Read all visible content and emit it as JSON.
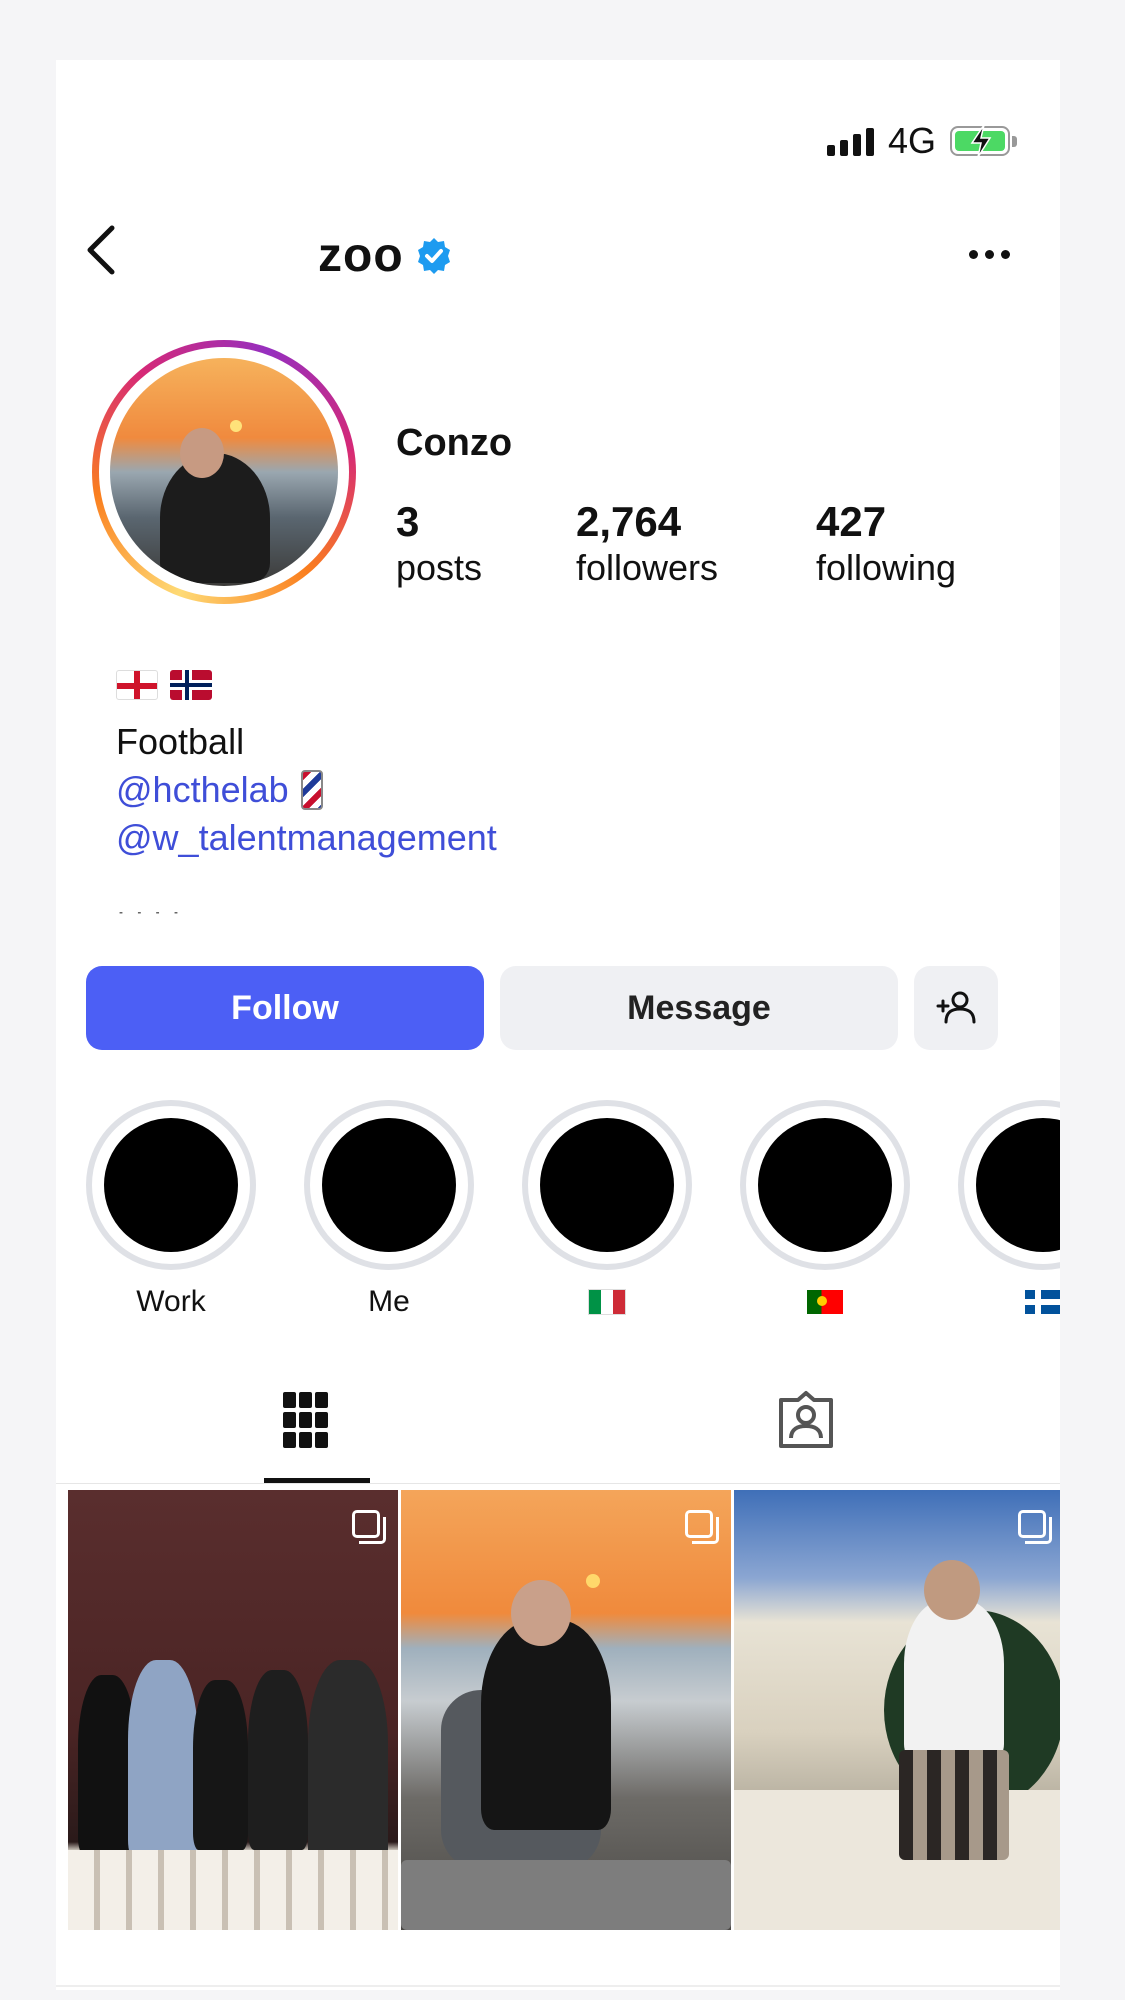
{
  "status_bar": {
    "network": "4G"
  },
  "header": {
    "username_partial": "zoo",
    "icons": [
      "back-chevron-icon",
      "verified-badge-icon",
      "more-options-icon"
    ]
  },
  "profile": {
    "display_name": "Conzo",
    "stats": [
      {
        "value": "3",
        "label": "posts"
      },
      {
        "value": "2,764",
        "label": "followers"
      },
      {
        "value": "427",
        "label": "following"
      }
    ]
  },
  "bio": {
    "flags": [
      "england-flag",
      "norway-flag"
    ],
    "line1": "Football",
    "link1": "@hcthelab",
    "link2": "@w_talentmanagement"
  },
  "actions": {
    "follow": "Follow",
    "message": "Message",
    "add_user_icon": "add-user-icon"
  },
  "highlights": [
    {
      "label": "Work"
    },
    {
      "label": "Me"
    },
    {
      "label": "",
      "flag": "italy-flag"
    },
    {
      "label": "",
      "flag": "portugal-flag"
    },
    {
      "label": "",
      "flag": "iceland-flag"
    }
  ],
  "tabs": [
    "grid-icon",
    "tagged-icon"
  ],
  "colors": {
    "follow_button": "#4c5ff5",
    "link": "#3f4ed8",
    "verified": "#1d9bf0"
  }
}
